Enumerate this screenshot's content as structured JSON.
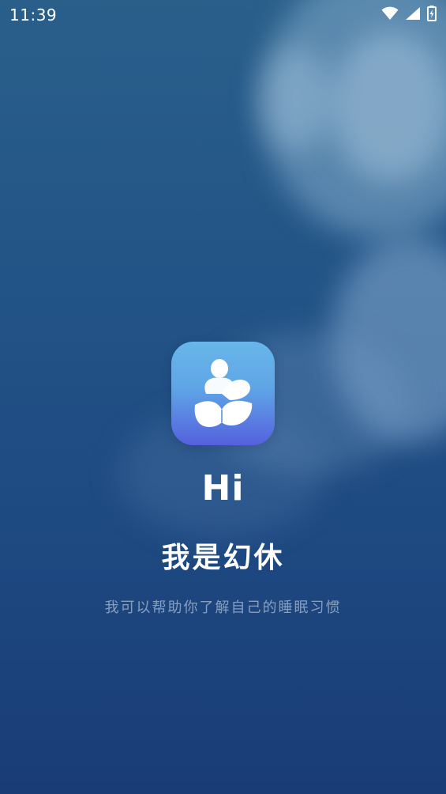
{
  "status_bar": {
    "time": "11:39",
    "icons": [
      "wifi-icon",
      "signal-icon",
      "battery-charging-icon"
    ]
  },
  "splash": {
    "logo_icon": "person-reading-book-icon",
    "greeting": "Hi",
    "intro": "我是幻休",
    "description": "我可以帮助你了解自己的睡眠习惯"
  },
  "colors": {
    "background_top": "#2a5f8a",
    "background_bottom": "#1a3c76",
    "logo_gradient_top": "#68b6ea",
    "logo_gradient_bottom": "#5560de"
  }
}
